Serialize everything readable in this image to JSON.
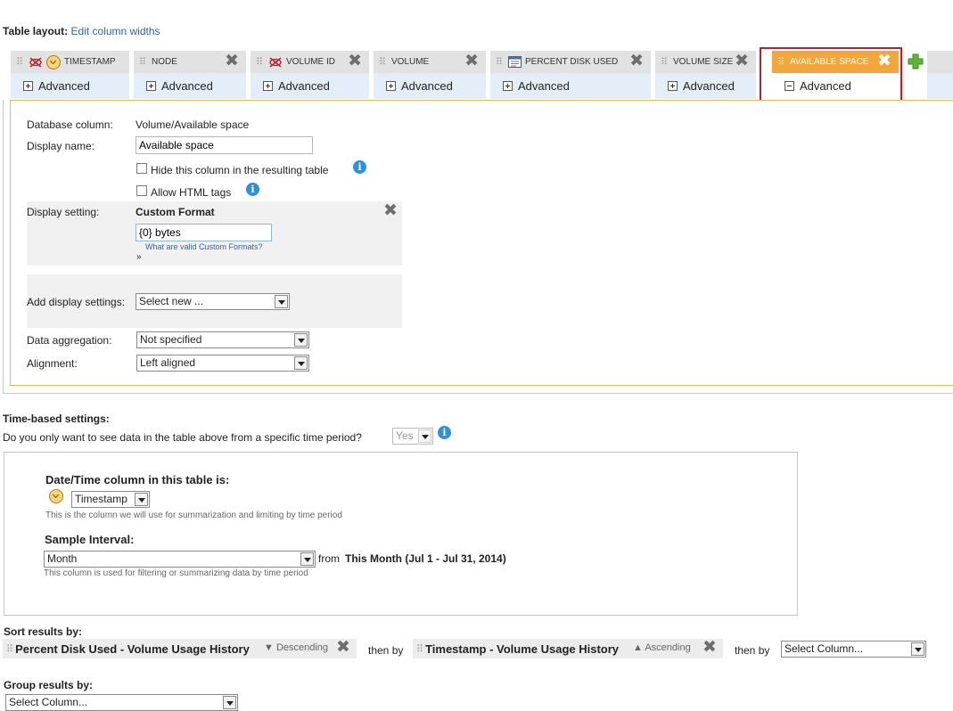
{
  "header": {
    "table_layout_label": "Table layout:",
    "edit_widths_link": "Edit column widths"
  },
  "columns": [
    {
      "name": "TIMESTAMP",
      "advanced_label": "Advanced",
      "hidden_icon": "eye-crossed-icon",
      "type_icon": "clock-icon"
    },
    {
      "name": "NODE",
      "advanced_label": "Advanced"
    },
    {
      "name": "VOLUME ID",
      "advanced_label": "Advanced",
      "hidden_icon": "eye-crossed-icon"
    },
    {
      "name": "VOLUME",
      "advanced_label": "Advanced"
    },
    {
      "name": "PERCENT DISK USED",
      "advanced_label": "Advanced",
      "type_icon": "table-icon"
    },
    {
      "name": "VOLUME SIZE",
      "advanced_label": "Advanced"
    },
    {
      "name": "AVAILABLE SPACE",
      "advanced_label": "Advanced",
      "active": true
    }
  ],
  "panel": {
    "database_column_label": "Database column:",
    "database_column_value": "Volume/Available space",
    "display_name_label": "Display name:",
    "display_name_value": "Available space",
    "hide_column_label": "Hide this column in the resulting table",
    "allow_html_label": "Allow HTML tags",
    "display_setting_label": "Display setting:",
    "custom_format_title": "Custom Format",
    "custom_format_value": "{0} bytes",
    "custom_format_help": "What are valid Custom Formats?",
    "custom_format_more": "»",
    "add_display_label": "Add display settings:",
    "add_display_value": "Select new ...",
    "data_aggregation_label": "Data aggregation:",
    "data_aggregation_value": "Not specified",
    "alignment_label": "Alignment:",
    "alignment_value": "Left aligned"
  },
  "time_settings": {
    "heading": "Time-based settings:",
    "question": "Do you only want to see data in the table above from a specific time period?",
    "answer": "Yes",
    "datetime_heading": "Date/Time column in this table is:",
    "datetime_value": "Timestamp",
    "datetime_note": "This is the column we will use for summarization and limiting by time period",
    "sample_heading": "Sample Interval:",
    "sample_value": "Month",
    "from_label": "from",
    "period": "This Month (Jul 1 - Jul 31, 2014)",
    "sample_note": "This column is used for filtering or summarizing data by time period"
  },
  "sort": {
    "heading": "Sort results by:",
    "first": "Percent Disk Used - Volume Usage History",
    "first_dir": "Descending",
    "then_by": "then by",
    "second": "Timestamp - Volume Usage History",
    "second_dir": "Ascending",
    "third_placeholder": "Select Column..."
  },
  "group": {
    "heading": "Group results by:",
    "placeholder": "Select Column..."
  },
  "colors": {
    "active_tab": "#f3a63a",
    "highlight": "#b0262c",
    "tab_bg": "#e3eef8",
    "info": "#2f8fd8"
  }
}
